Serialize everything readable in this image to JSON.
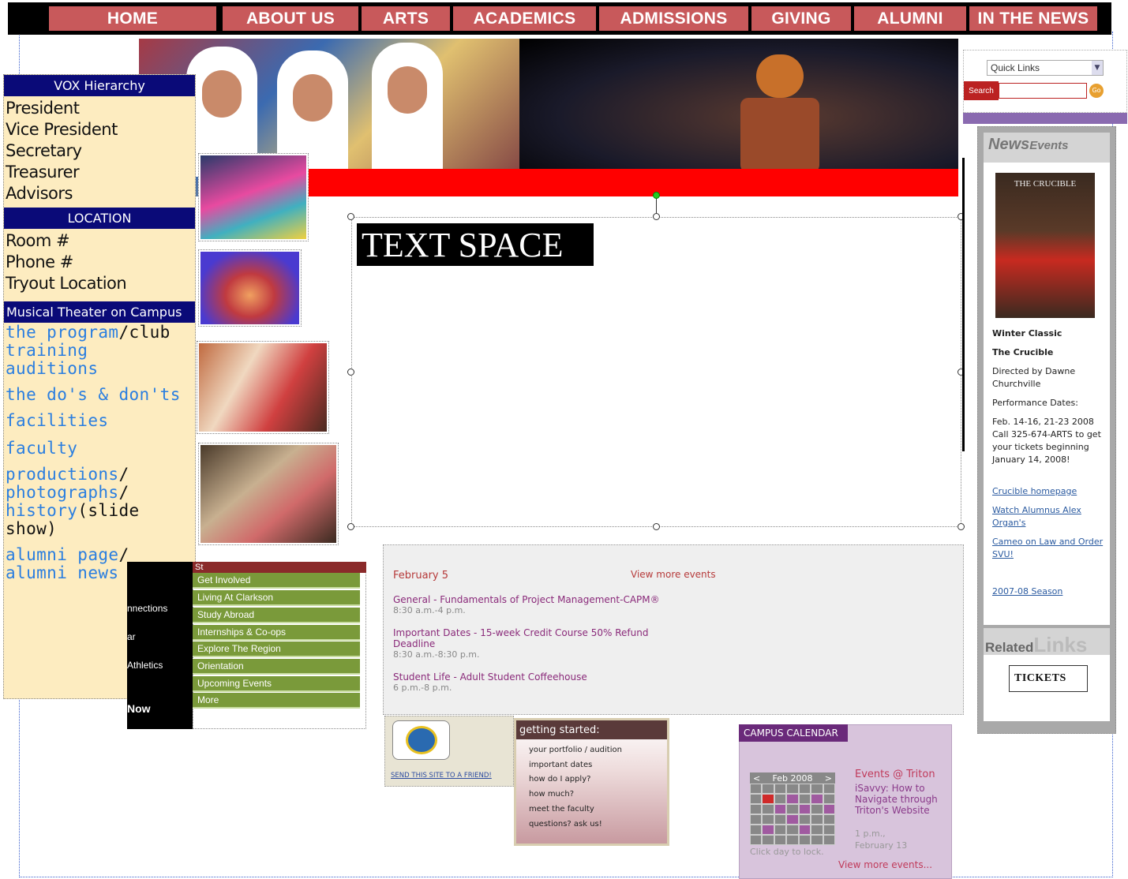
{
  "nav": {
    "items": [
      "HOME",
      "ABOUT US",
      "ARTS",
      "ACADEMICS",
      "ADMISSIONS",
      "GIVING",
      "ALUMNI",
      "IN THE NEWS"
    ]
  },
  "sidebar": {
    "hierarchy_heading": "VOX Hierarchy",
    "hierarchy_items": [
      "President",
      "Vice President",
      "Secretary",
      "Treasurer",
      "Advisors"
    ],
    "location_heading": "LOCATION",
    "location_items": [
      "Room #",
      "Phone #",
      "Tryout Location"
    ],
    "musical_heading": "Musical Theater on Campus",
    "links": {
      "program": "the program",
      "club": "/club",
      "training": "training",
      "auditions": "auditions",
      "dos_donts": "the do's & don'ts",
      "facilities": "facilities",
      "faculty": "faculty",
      "productions": "productions",
      "photographs": "photographs",
      "history": "history",
      "slide": "(slide",
      "show": "show)",
      "alumni_page": "alumni page",
      "alumni_news": "alumni news",
      "slash": "/"
    }
  },
  "text_space": {
    "label": "TEXT SPACE"
  },
  "right_panel": {
    "quick_links": "Quick Links",
    "search_label": "Search",
    "search_go": "Go",
    "news_title_1": "News",
    "news_title_2": "Events",
    "poster_title": "THE CRUCIBLE",
    "winter_classic": "Winter Classic",
    "the_crucible": "The Crucible",
    "directed_by": "Directed by Dawne Churchville",
    "performance_dates_label": "Performance Dates:",
    "performance_dates": "Feb. 14-16, 21-23 2008 Call 325-674-ARTS to get your tickets beginning January 14, 2008!",
    "link_crucible": "Crucible homepage",
    "link_watch": "Watch Alumnus Alex Organ's",
    "link_cameo": "Cameo on Law and Order SVU!",
    "link_season": "2007-08 Season",
    "related_1": "Related",
    "related_2": "Links",
    "tickets": "TICKETS"
  },
  "events": {
    "date": "February 5",
    "view_more": "View more events",
    "items": [
      {
        "title": "General - Fundamentals of Project Management-CAPM®",
        "time": "8:30 a.m.-4 p.m."
      },
      {
        "title": "Important Dates - 15-week Credit Course 50% Refund Deadline",
        "time": "8:30 a.m.-8:30 p.m."
      },
      {
        "title": "Student Life - Adult Student Coffeehouse",
        "time": "6 p.m.-8 p.m."
      }
    ]
  },
  "green_menu": {
    "left_items": [
      "nnections",
      "ar",
      "Athletics",
      "Now"
    ],
    "top_label": "St",
    "items": [
      "Get Involved",
      "Living At Clarkson",
      "Study Abroad",
      "Internships & Co-ops",
      "Explore The Region",
      "Orientation",
      "Upcoming Events",
      "More"
    ]
  },
  "send_site": {
    "link": "SEND THIS SITE TO A FRIEND!"
  },
  "getting_started": {
    "heading": "getting started:",
    "items": [
      "your portfolio / audition",
      "important dates",
      "how do I apply?",
      "how much?",
      "meet the faculty",
      "questions? ask us!"
    ]
  },
  "campus_calendar": {
    "heading": "CAMPUS CALENDAR",
    "month": "Feb 2008",
    "prev": "<",
    "next": ">",
    "hint": "Click day to lock.",
    "events_title": "Events @ Triton",
    "event_name": "iSavvy: How to Navigate through Triton's Website",
    "event_time": "1 p.m.,",
    "event_date": "February 13",
    "view_more": "View more events..."
  }
}
